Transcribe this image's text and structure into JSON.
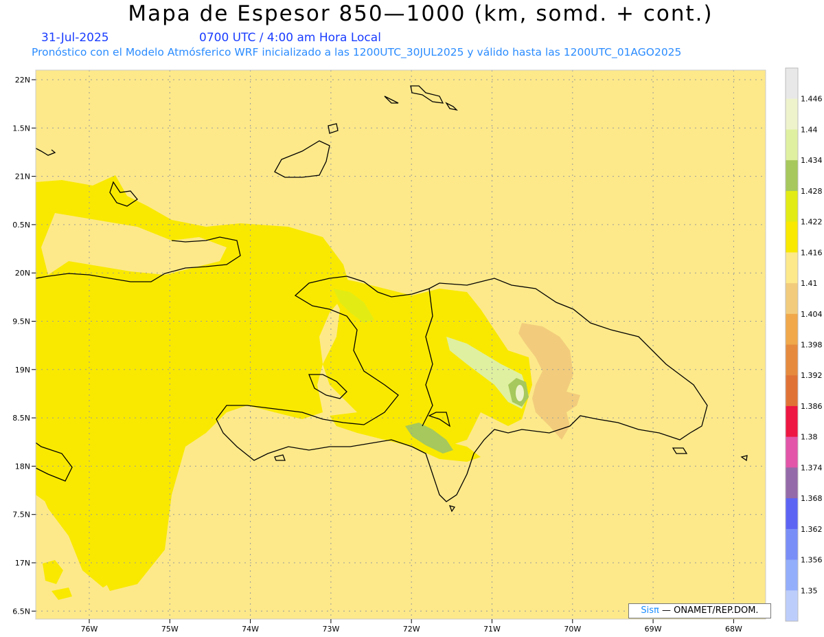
{
  "header": {
    "title": "Mapa de Espesor 850—1000 (km, somd. + cont.)",
    "date": "31-Jul-2025",
    "time": "0700 UTC / 4:00 am Hora Local",
    "subtitle": "Pronóstico con el Modelo Atmósferico WRF inicializado a las 1200UTC_30JUL2025 y válido hasta las  1200UTC_01AGO2025"
  },
  "axes": {
    "lat_labels": [
      "22N",
      "1.5N",
      "21N",
      "0.5N",
      "20N",
      "9.5N",
      "19N",
      "8.5N",
      "18N",
      "7.5N",
      "17N",
      "6.5N"
    ],
    "lon_labels": [
      "76W",
      "75W",
      "74W",
      "73W",
      "72W",
      "71W",
      "70W",
      "69W",
      "68W"
    ]
  },
  "colorbar": {
    "labels": [
      "1.446",
      "1.44",
      "1.434",
      "1.428",
      "1.422",
      "1.416",
      "1.41",
      "1.404",
      "1.398",
      "1.392",
      "1.386",
      "1.38",
      "1.374",
      "1.368",
      "1.362",
      "1.356",
      "1.35"
    ],
    "colors": [
      "#e8e8e8",
      "#eef3cc",
      "#dff0a0",
      "#a6c85c",
      "#e2ec14",
      "#f9e900",
      "#fde98a",
      "#f2cc7c",
      "#f0a84a",
      "#e68a3e",
      "#e07236",
      "#ee1642",
      "#e255a8",
      "#956aa8",
      "#5c64f4",
      "#7a8ef8",
      "#93aefb",
      "#bdcdfb"
    ]
  },
  "fields": {
    "background_color": "#fde98a",
    "yellow_color": "#f9e900",
    "tan_color": "#f2cc7c",
    "green_color": "#a6c85c",
    "light_green_color": "#dff0a0"
  },
  "credit": {
    "brand": "Sisπ",
    "text": "— ONAMET/REP.DOM."
  }
}
